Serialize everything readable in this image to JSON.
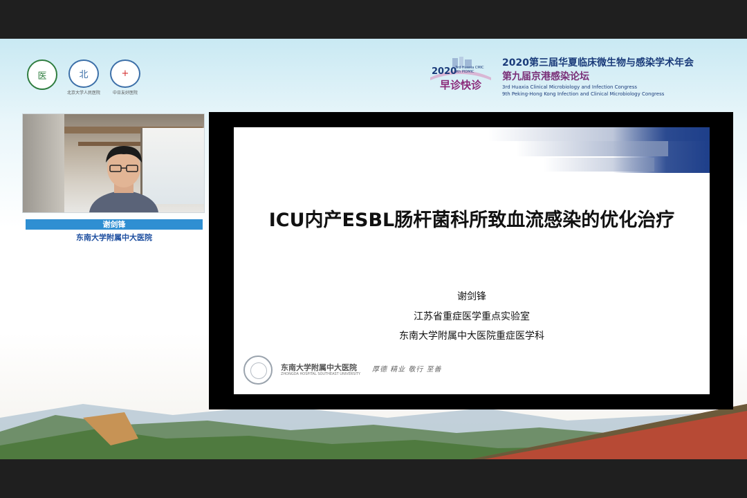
{
  "header": {
    "logos": [
      {
        "icon": "medical-association-seal-icon",
        "glyph": "医",
        "caption": ""
      },
      {
        "icon": "peking-university-hospital-seal-icon",
        "glyph": "北",
        "caption": "北京大学人民医院"
      },
      {
        "icon": "china-japan-friendship-hospital-seal-icon",
        "glyph": "+",
        "caption": "中日友好医院"
      }
    ],
    "congress": {
      "year": "2020",
      "tiny_lines": [
        "3rd Huaxia CMIC",
        "9th PIDMIC"
      ],
      "slogan": "早诊快诊",
      "title": "2020第三届华夏临床微生物与感染学术年会",
      "subtitle": "第九届京港感染论坛",
      "english_line1": "3rd Huaxia Clinical Microbiology and Infection Congress",
      "english_line2": "9th Peking-Hong Kong Infection and Clinical Microbiology Congress"
    }
  },
  "speaker_panel": {
    "name": "谢剑锋",
    "institution": "东南大学附属中大医院"
  },
  "slide": {
    "title": "ICU内产ESBL肠杆菌科所致血流感染的优化治疗",
    "speaker": "谢剑锋",
    "affiliation_1": "江苏省重症医学重点实验室",
    "affiliation_2": "东南大学附属中大医院重症医学科",
    "footer": {
      "hospital": "东南大学附属中大医院",
      "hospital_en": "ZHONGDA HOSPITAL SOUTHEAST UNIVERSITY",
      "motto": "厚德 精业 敬行 至善"
    }
  },
  "colors": {
    "accent_blue": "#1a3b7a",
    "name_bar": "#2f8fd2",
    "congress_purple": "#7a2f78"
  }
}
